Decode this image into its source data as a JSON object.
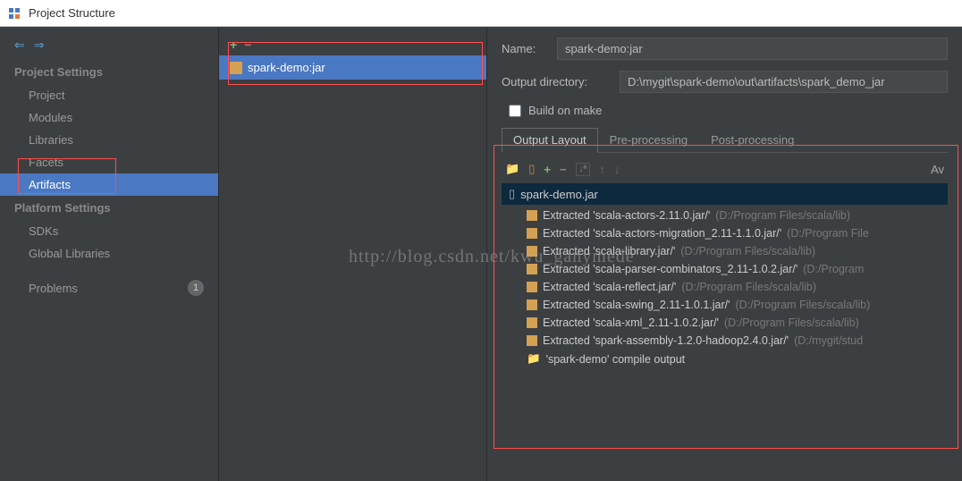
{
  "window": {
    "title": "Project Structure"
  },
  "sidebar": {
    "sections": [
      {
        "header": "Project Settings",
        "items": [
          "Project",
          "Modules",
          "Libraries",
          "Facets",
          "Artifacts"
        ]
      },
      {
        "header": "Platform Settings",
        "items": [
          "SDKs",
          "Global Libraries"
        ]
      }
    ],
    "problems": {
      "label": "Problems",
      "count": "1"
    },
    "selected": "Artifacts"
  },
  "artifacts": {
    "selected": "spark-demo:jar"
  },
  "details": {
    "nameLabel": "Name:",
    "nameValue": "spark-demo:jar",
    "outputDirLabel": "Output directory:",
    "outputDirValue": "D:\\mygit\\spark-demo\\out\\artifacts\\spark_demo_jar",
    "buildOnMakeLabel": "Build on make",
    "tabs": [
      "Output Layout",
      "Pre-processing",
      "Post-processing"
    ],
    "activeTab": "Output Layout",
    "availableLabel": "Av",
    "tree": {
      "root": "spark-demo.jar",
      "items": [
        {
          "label": "Extracted 'scala-actors-2.11.0.jar/'",
          "path": "(D:/Program Files/scala/lib)"
        },
        {
          "label": "Extracted 'scala-actors-migration_2.11-1.1.0.jar/'",
          "path": "(D:/Program File"
        },
        {
          "label": "Extracted 'scala-library.jar/'",
          "path": "(D:/Program Files/scala/lib)"
        },
        {
          "label": "Extracted 'scala-parser-combinators_2.11-1.0.2.jar/'",
          "path": "(D:/Program"
        },
        {
          "label": "Extracted 'scala-reflect.jar/'",
          "path": "(D:/Program Files/scala/lib)"
        },
        {
          "label": "Extracted 'scala-swing_2.11-1.0.1.jar/'",
          "path": "(D:/Program Files/scala/lib)"
        },
        {
          "label": "Extracted 'scala-xml_2.11-1.0.2.jar/'",
          "path": "(D:/Program Files/scala/lib)"
        },
        {
          "label": "Extracted 'spark-assembly-1.2.0-hadoop2.4.0.jar/'",
          "path": "(D:/mygit/stud"
        }
      ],
      "compileOutput": "'spark-demo' compile output"
    }
  },
  "watermark": "http://blog.csdn.net/kwu_ganymede"
}
